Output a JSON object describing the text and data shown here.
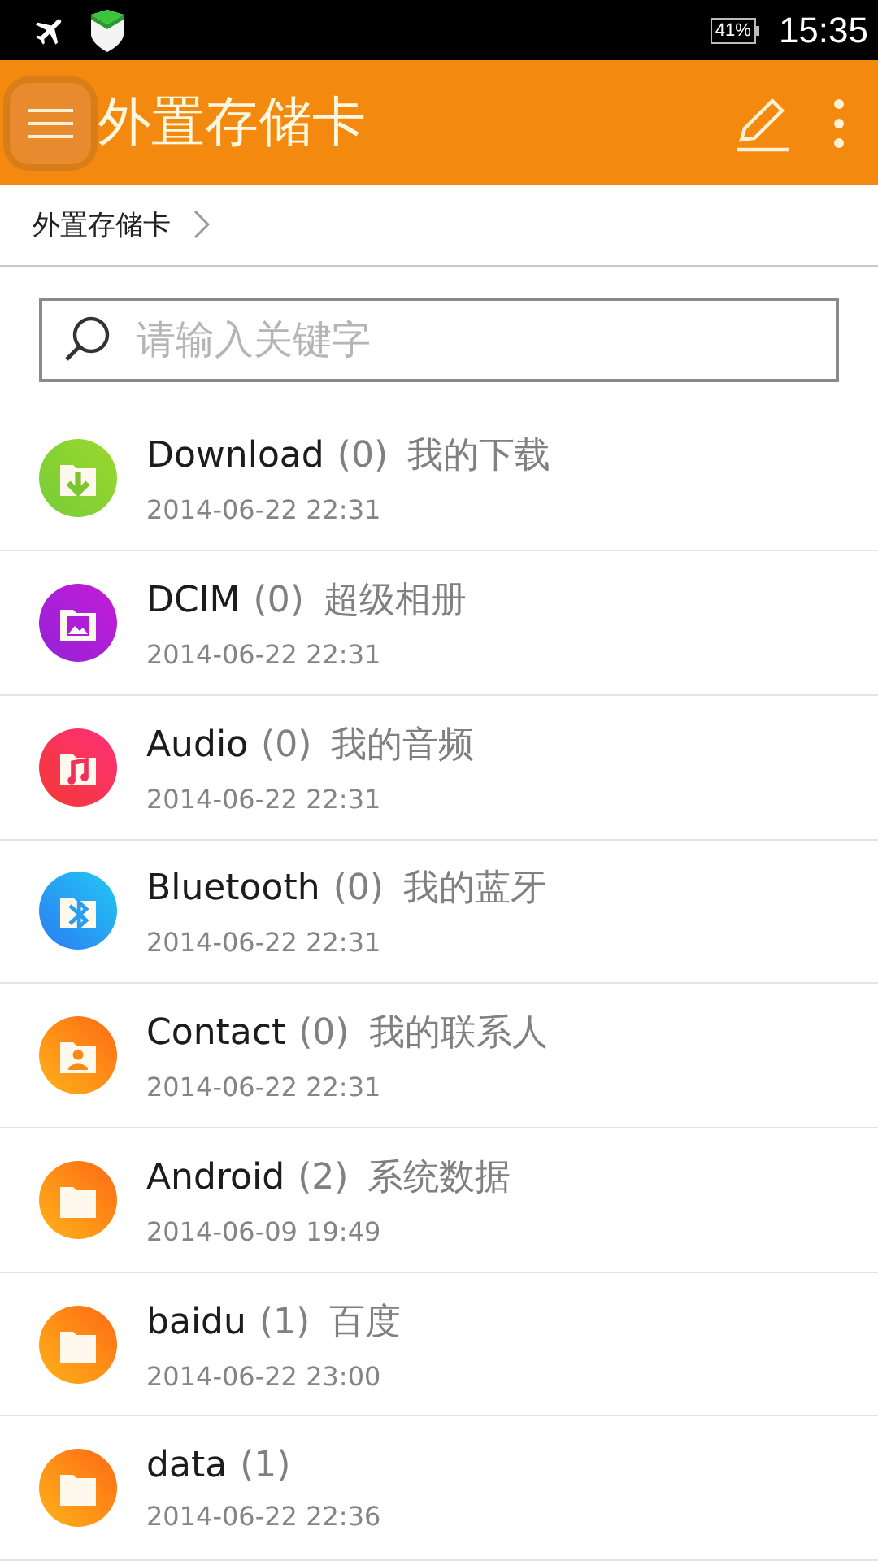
{
  "status_bar": {
    "battery": "41%",
    "time": "15:35"
  },
  "toolbar": {
    "title": "外置存储卡"
  },
  "breadcrumb": {
    "items": [
      "外置存储卡"
    ]
  },
  "search": {
    "placeholder": "请输入关键字"
  },
  "files": [
    {
      "kind": "download",
      "name": "Download",
      "count": "(0)",
      "description": "我的下载",
      "date": "2014-06-22 22:31"
    },
    {
      "kind": "image",
      "name": "DCIM",
      "count": "(0)",
      "description": "超级相册",
      "date": "2014-06-22 22:31"
    },
    {
      "kind": "music",
      "name": "Audio",
      "count": "(0)",
      "description": "我的音频",
      "date": "2014-06-22 22:31"
    },
    {
      "kind": "bluetooth",
      "name": "Bluetooth",
      "count": "(0)",
      "description": "我的蓝牙",
      "date": "2014-06-22 22:31"
    },
    {
      "kind": "contact",
      "name": "Contact",
      "count": "(0)",
      "description": "我的联系人",
      "date": "2014-06-22 22:31"
    },
    {
      "kind": "folder",
      "name": "Android",
      "count": "(2)",
      "description": "系统数据",
      "date": "2014-06-09 19:49"
    },
    {
      "kind": "folder",
      "name": "baidu",
      "count": "(1)",
      "description": "百度",
      "date": "2014-06-22 23:00"
    },
    {
      "kind": "folder",
      "name": "data",
      "count": "(1)",
      "date": "2014-06-22 22:36"
    }
  ]
}
